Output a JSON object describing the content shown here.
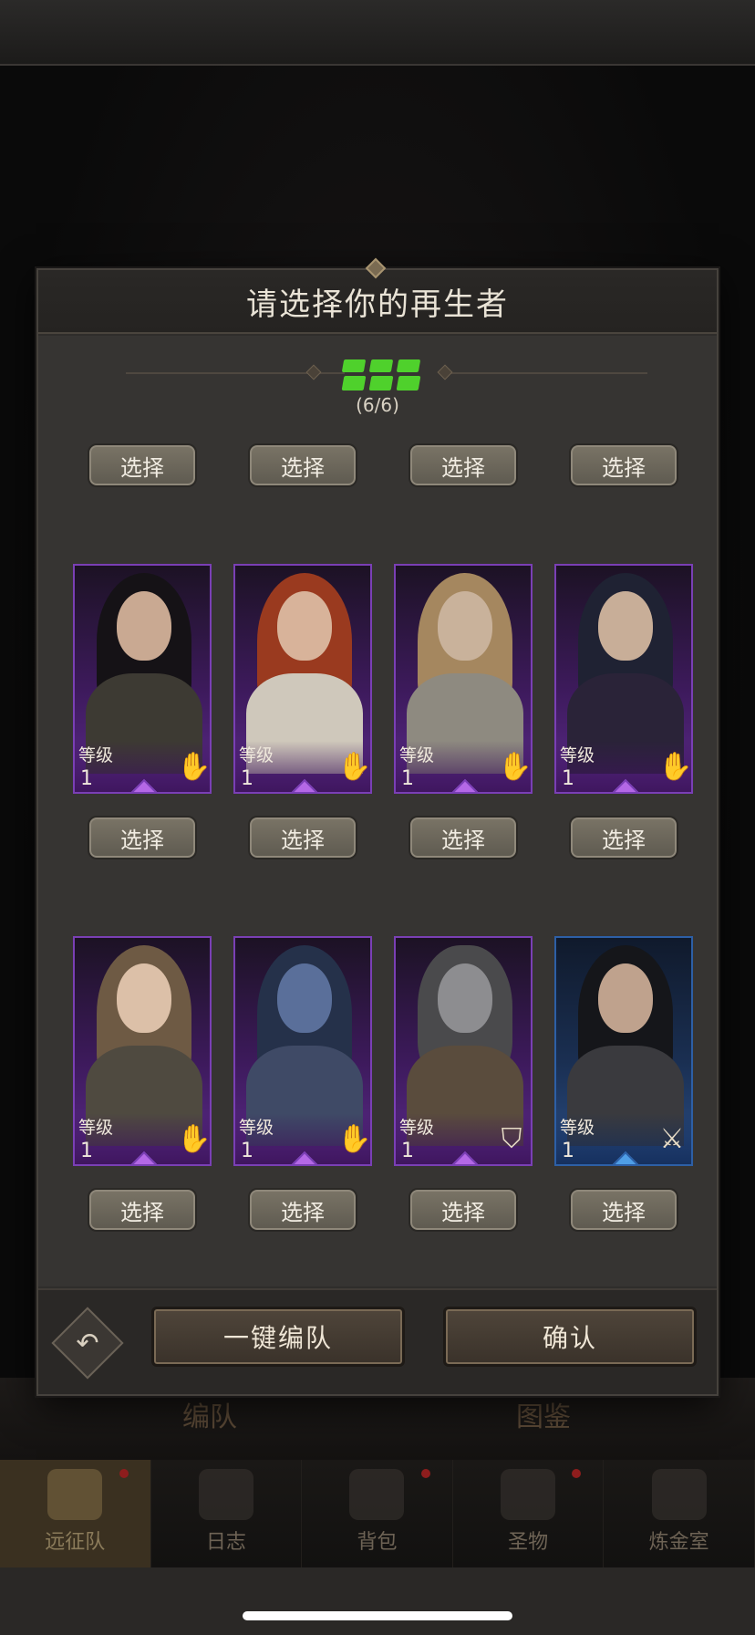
{
  "modal": {
    "title": "请选择你的再生者",
    "slot_count": "(6/6)",
    "select_label": "选择",
    "auto_team_label": "一键编队",
    "confirm_label": "确认",
    "back_icon": "undo-icon"
  },
  "background_tabs": {
    "left": "编队",
    "right": "图鉴"
  },
  "bottom_nav": [
    {
      "label": "远征队",
      "icon": "helmet-icon",
      "active": true
    },
    {
      "label": "日志",
      "icon": "scroll-icon",
      "active": false
    },
    {
      "label": "背包",
      "icon": "bag-icon",
      "active": false
    },
    {
      "label": "圣物",
      "icon": "chalice-icon",
      "active": false
    },
    {
      "label": "炼金室",
      "icon": "alchemy-icon",
      "active": false
    }
  ],
  "cards": [
    {
      "level_label": "等级",
      "level": "1",
      "class_icon": "hand-icon",
      "rarity": "purple"
    },
    {
      "level_label": "等级",
      "level": "1",
      "class_icon": "hand-icon",
      "rarity": "purple"
    },
    {
      "level_label": "等级",
      "level": "1",
      "class_icon": "hand-icon",
      "rarity": "purple"
    },
    {
      "level_label": "等级",
      "level": "1",
      "class_icon": "hand-icon",
      "rarity": "purple"
    },
    {
      "level_label": "等级",
      "level": "1",
      "class_icon": "hand-icon",
      "rarity": "purple"
    },
    {
      "level_label": "等级",
      "level": "1",
      "class_icon": "hand-icon",
      "rarity": "purple"
    },
    {
      "level_label": "等级",
      "level": "1",
      "class_icon": "shield-icon",
      "rarity": "purple"
    },
    {
      "level_label": "等级",
      "level": "1",
      "class_icon": "sword-icon",
      "rarity": "blue"
    }
  ],
  "colors": {
    "slot_active": "#4fd12c",
    "rarity_purple": "#7a3fb5",
    "rarity_blue": "#2d5fa6"
  }
}
